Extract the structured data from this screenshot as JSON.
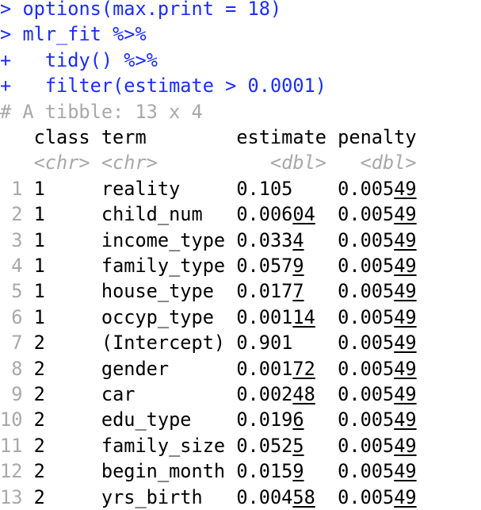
{
  "colors": {
    "code": "#1a2cff",
    "meta": "#a8a8a8",
    "text": "#000000"
  },
  "console": {
    "commands": [
      {
        "prompt": ">",
        "text": "options(max.print = 18)"
      },
      {
        "prompt": ">",
        "text": "mlr_fit %>%"
      },
      {
        "prompt": "+",
        "text": "  tidy() %>%"
      },
      {
        "prompt": "+",
        "text": "  filter(estimate > 0.0001)"
      }
    ],
    "tibble_header": "# A tibble: 13 x 4",
    "columns": [
      "class",
      "term",
      "estimate",
      "penalty"
    ],
    "types": [
      "<chr>",
      "<chr>",
      "<dbl>",
      "<dbl>"
    ],
    "rows": [
      {
        "n": "1",
        "class": "1",
        "term": "reality",
        "est_main": "0.105",
        "est_u": "",
        "pen_main": "0.005",
        "pen_u": "49"
      },
      {
        "n": "2",
        "class": "1",
        "term": "child_num",
        "est_main": "0.006",
        "est_u": "04",
        "pen_main": "0.005",
        "pen_u": "49"
      },
      {
        "n": "3",
        "class": "1",
        "term": "income_type",
        "est_main": "0.033",
        "est_u": "4",
        "pen_main": "0.005",
        "pen_u": "49"
      },
      {
        "n": "4",
        "class": "1",
        "term": "family_type",
        "est_main": "0.057",
        "est_u": "9",
        "pen_main": "0.005",
        "pen_u": "49"
      },
      {
        "n": "5",
        "class": "1",
        "term": "house_type",
        "est_main": "0.017",
        "est_u": "7",
        "pen_main": "0.005",
        "pen_u": "49"
      },
      {
        "n": "6",
        "class": "1",
        "term": "occyp_type",
        "est_main": "0.001",
        "est_u": "14",
        "pen_main": "0.005",
        "pen_u": "49"
      },
      {
        "n": "7",
        "class": "2",
        "term": "(Intercept)",
        "est_main": "0.901",
        "est_u": "",
        "pen_main": "0.005",
        "pen_u": "49"
      },
      {
        "n": "8",
        "class": "2",
        "term": "gender",
        "est_main": "0.001",
        "est_u": "72",
        "pen_main": "0.005",
        "pen_u": "49"
      },
      {
        "n": "9",
        "class": "2",
        "term": "car",
        "est_main": "0.002",
        "est_u": "48",
        "pen_main": "0.005",
        "pen_u": "49"
      },
      {
        "n": "10",
        "class": "2",
        "term": "edu_type",
        "est_main": "0.019",
        "est_u": "6",
        "pen_main": "0.005",
        "pen_u": "49"
      },
      {
        "n": "11",
        "class": "2",
        "term": "family_size",
        "est_main": "0.052",
        "est_u": "5",
        "pen_main": "0.005",
        "pen_u": "49"
      },
      {
        "n": "12",
        "class": "2",
        "term": "begin_month",
        "est_main": "0.015",
        "est_u": "9",
        "pen_main": "0.005",
        "pen_u": "49"
      },
      {
        "n": "13",
        "class": "2",
        "term": "yrs_birth",
        "est_main": "0.004",
        "est_u": "58",
        "pen_main": "0.005",
        "pen_u": "49"
      }
    ]
  }
}
